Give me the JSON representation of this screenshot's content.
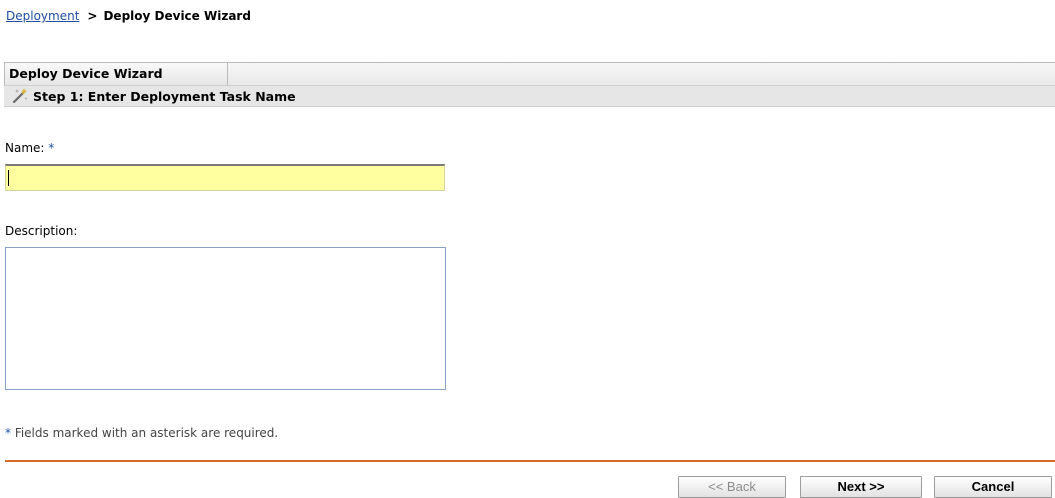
{
  "breadcrumb": {
    "link": "Deployment",
    "separator": ">",
    "current": "Deploy Device Wizard"
  },
  "wizard": {
    "tab_label": "Deploy Device Wizard",
    "step_icon": "wand-icon",
    "step_title": "Step 1: Enter Deployment Task Name"
  },
  "form": {
    "name_label": "Name:",
    "name_required_marker": "*",
    "name_value": "",
    "description_label": "Description:",
    "description_value": ""
  },
  "footer_note": {
    "marker": "*",
    "text": " Fields marked with an asterisk are required."
  },
  "buttons": {
    "back": "<< Back",
    "next": "Next >>",
    "cancel": "Cancel"
  },
  "colors": {
    "link": "#1f4fa3",
    "required_field_bg": "#ffff9f",
    "divider": "#d4692a"
  }
}
